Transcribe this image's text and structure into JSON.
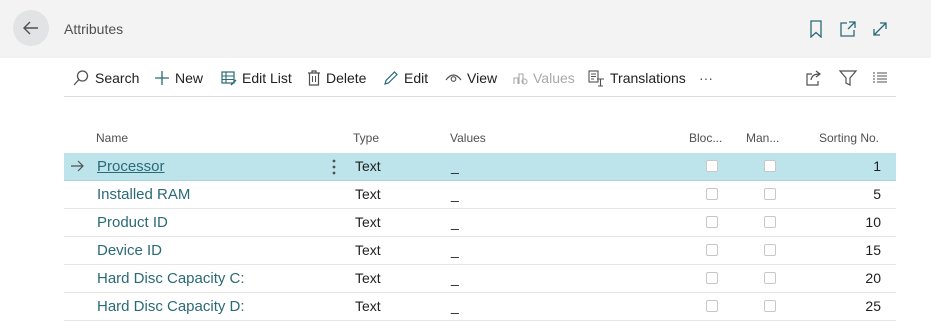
{
  "header": {
    "title": "Attributes",
    "icons": [
      "back-arrow-icon",
      "bookmark-icon",
      "open-new-window-icon",
      "expand-icon"
    ]
  },
  "actions": {
    "search": "Search",
    "new": "New",
    "edit_list": "Edit List",
    "delete": "Delete",
    "edit": "Edit",
    "view": "View",
    "values": "Values",
    "translations": "Translations",
    "more": "···"
  },
  "table": {
    "columns": {
      "name": "Name",
      "type": "Type",
      "values": "Values",
      "blocked": "Bloc...",
      "mandatory": "Man...",
      "sorting_no": "Sorting No."
    },
    "rows": [
      {
        "name": "Processor",
        "type": "Text",
        "values": "_",
        "blocked": false,
        "mandatory": false,
        "sorting_no": "1"
      },
      {
        "name": "Installed RAM",
        "type": "Text",
        "values": "_",
        "blocked": false,
        "mandatory": false,
        "sorting_no": "5"
      },
      {
        "name": "Product ID",
        "type": "Text",
        "values": "_",
        "blocked": false,
        "mandatory": false,
        "sorting_no": "10"
      },
      {
        "name": "Device ID",
        "type": "Text",
        "values": "_",
        "blocked": false,
        "mandatory": false,
        "sorting_no": "15"
      },
      {
        "name": "Hard Disc Capacity C:",
        "type": "Text",
        "values": "_",
        "blocked": false,
        "mandatory": false,
        "sorting_no": "20"
      },
      {
        "name": "Hard Disc Capacity D:",
        "type": "Text",
        "values": "_",
        "blocked": false,
        "mandatory": false,
        "sorting_no": "25"
      }
    ]
  },
  "colors": {
    "accent": "#2a6a77",
    "selected_row": "#bce4ea",
    "disabled_text": "#a8a8a8"
  }
}
